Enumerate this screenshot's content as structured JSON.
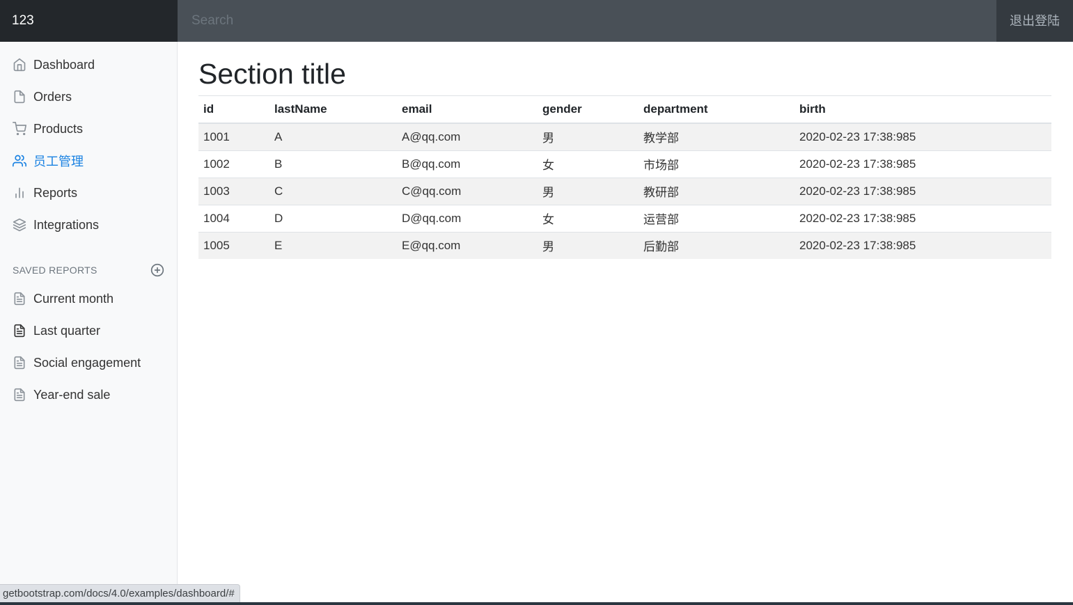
{
  "navbar": {
    "brand": "123",
    "search_placeholder": "Search",
    "signout": "退出登陆"
  },
  "sidebar": {
    "items": [
      {
        "label": "Dashboard",
        "icon": "home-icon"
      },
      {
        "label": "Orders",
        "icon": "file-icon"
      },
      {
        "label": "Products",
        "icon": "shopping-cart-icon"
      },
      {
        "label": "员工管理",
        "icon": "users-icon",
        "active": true
      },
      {
        "label": "Reports",
        "icon": "bar-chart-icon"
      },
      {
        "label": "Integrations",
        "icon": "layers-icon"
      }
    ],
    "saved_reports_heading": "SAVED REPORTS",
    "saved_reports": [
      {
        "label": "Current month",
        "icon": "file-text-icon"
      },
      {
        "label": "Last quarter",
        "icon": "file-text-icon"
      },
      {
        "label": "Social engagement",
        "icon": "file-text-icon"
      },
      {
        "label": "Year-end sale",
        "icon": "file-text-icon"
      }
    ]
  },
  "main": {
    "title": "Section title",
    "table": {
      "headers": [
        "id",
        "lastName",
        "email",
        "gender",
        "department",
        "birth"
      ],
      "rows": [
        [
          "1001",
          "A",
          "A@qq.com",
          "男",
          "教学部",
          "2020-02-23 17:38:985"
        ],
        [
          "1002",
          "B",
          "B@qq.com",
          "女",
          "市场部",
          "2020-02-23 17:38:985"
        ],
        [
          "1003",
          "C",
          "C@qq.com",
          "男",
          "教研部",
          "2020-02-23 17:38:985"
        ],
        [
          "1004",
          "D",
          "D@qq.com",
          "女",
          "运营部",
          "2020-02-23 17:38:985"
        ],
        [
          "1005",
          "E",
          "E@qq.com",
          "男",
          "后勤部",
          "2020-02-23 17:38:985"
        ]
      ]
    }
  },
  "status_url": "getbootstrap.com/docs/4.0/examples/dashboard/#",
  "colors": {
    "accent": "#1a82e2",
    "navbar": "#343a40",
    "brand_bg": "#23272b",
    "search_bg": "#495057",
    "sidebar_bg": "#f8f9fa",
    "stripe": "#f2f2f2"
  }
}
